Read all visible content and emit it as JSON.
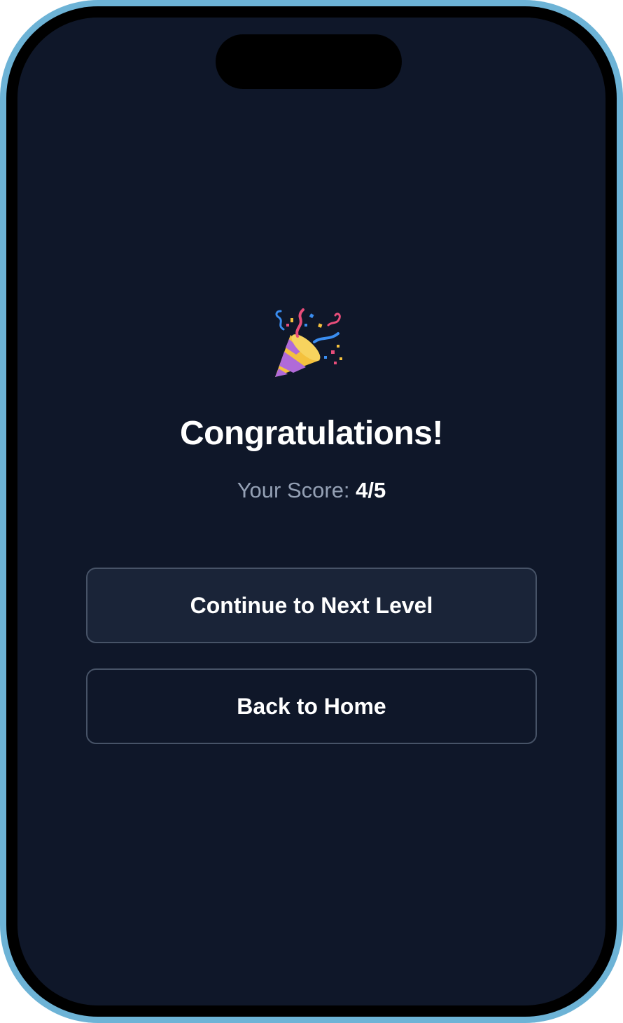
{
  "screen": {
    "icon": "party-popper-icon",
    "title": "Congratulations!",
    "score_label": "Your Score:",
    "score_value": "4/5"
  },
  "buttons": {
    "continue_label": "Continue to Next Level",
    "home_label": "Back to Home"
  },
  "colors": {
    "background": "#0f1729",
    "frame": "#6db3d6",
    "button_primary_bg": "#1a2438",
    "button_border": "#475367",
    "muted_text": "#94a0b4"
  }
}
